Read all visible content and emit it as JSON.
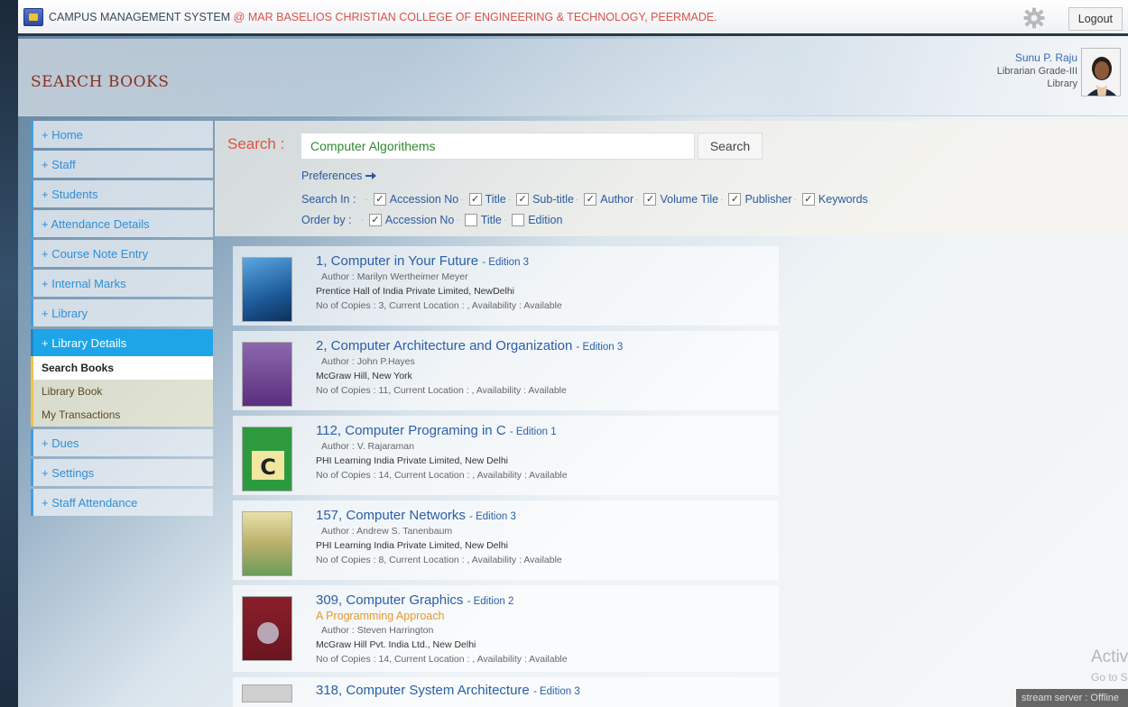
{
  "topbar": {
    "app_title": "CAMPUS MANAGEMENT SYSTEM",
    "at": "@",
    "college": "MAR BASELIOS CHRISTIAN COLLEGE OF ENGINEERING & TECHNOLOGY, PEERMADE.",
    "logout_label": "Logout"
  },
  "header": {
    "page_title": "SEARCH BOOKS",
    "user_name": "Sunu P. Raju",
    "user_role": "Librarian Grade-III",
    "user_dept": "Library"
  },
  "sidebar": {
    "items": [
      {
        "label": "+ Home"
      },
      {
        "label": "+ Staff"
      },
      {
        "label": "+ Students"
      },
      {
        "label": "+ Attendance Details"
      },
      {
        "label": "+ Course Note Entry"
      },
      {
        "label": "+ Internal Marks"
      },
      {
        "label": "+ Library"
      },
      {
        "label": "+ Library Details"
      }
    ],
    "sub_items": [
      {
        "label": "Search Books"
      },
      {
        "label": "Library Book"
      },
      {
        "label": "My Transactions"
      }
    ],
    "items_after": [
      {
        "label": "+ Dues"
      },
      {
        "label": "+ Settings"
      },
      {
        "label": "+ Staff Attendance"
      }
    ]
  },
  "search": {
    "label": "Search :",
    "query": "Computer Algorithems",
    "button_label": "Search",
    "preferences_label": "Preferences",
    "search_in_label": "Search In :",
    "search_in": [
      {
        "label": "Accession No",
        "checked": true
      },
      {
        "label": "Title",
        "checked": true
      },
      {
        "label": "Sub-title",
        "checked": true
      },
      {
        "label": "Author",
        "checked": true
      },
      {
        "label": "Volume Tile",
        "checked": true
      },
      {
        "label": "Publisher",
        "checked": true
      },
      {
        "label": "Keywords",
        "checked": true
      }
    ],
    "order_by_label": "Order by :",
    "order_by": [
      {
        "label": "Accession No",
        "checked": true
      },
      {
        "label": "Title",
        "checked": false
      },
      {
        "label": "Edition",
        "checked": false
      }
    ]
  },
  "results": [
    {
      "title": "1, Computer in Your Future",
      "edition": "- Edition 3",
      "subtitle": "",
      "author": "Author : Marilyn Wertheimer Meyer",
      "publisher": "Prentice Hall of India Private Limited, NewDelhi",
      "copies": "No of Copies : 3, Current Location : , Availability : Available",
      "cover_color": "#2b6fb2"
    },
    {
      "title": "2, Computer Architecture and Organization",
      "edition": "- Edition 3",
      "subtitle": "",
      "author": "Author : John P.Hayes",
      "publisher": "McGraw Hill, New York",
      "copies": "No of Copies : 11, Current Location : , Availability : Available",
      "cover_color": "#6b3f8f"
    },
    {
      "title": "112, Computer Programing in C",
      "edition": "- Edition 1",
      "subtitle": "",
      "author": "Author : V. Rajaraman",
      "publisher": "PHI Learning India Private Limited, New Delhi",
      "copies": "No of Copies : 14, Current Location : , Availability : Available",
      "cover_color": "#2e9a3e"
    },
    {
      "title": "157, Computer Networks",
      "edition": "- Edition 3",
      "subtitle": "",
      "author": "Author : Andrew S. Tanenbaum",
      "publisher": "PHI Learning India Private Limited, New Delhi",
      "copies": "No of Copies : 8, Current Location : , Availability : Available",
      "cover_color": "#c9c07a"
    },
    {
      "title": "309, Computer Graphics",
      "edition": "- Edition 2",
      "subtitle": "A Programming Approach",
      "author": "Author : Steven Harrington",
      "publisher": "McGraw Hill Pvt. India Ltd., New Delhi",
      "copies": "No of Copies : 14, Current Location : , Availability : Available",
      "cover_color": "#8a1f2a"
    },
    {
      "title": "318, Computer System Architecture",
      "edition": "- Edition 3",
      "subtitle": "",
      "author": "",
      "publisher": "",
      "copies": "",
      "cover_color": "#cccccc"
    }
  ],
  "watermark": {
    "line1": "Activ",
    "line2": "Go to S"
  },
  "stream_status": "stream server : Offline"
}
